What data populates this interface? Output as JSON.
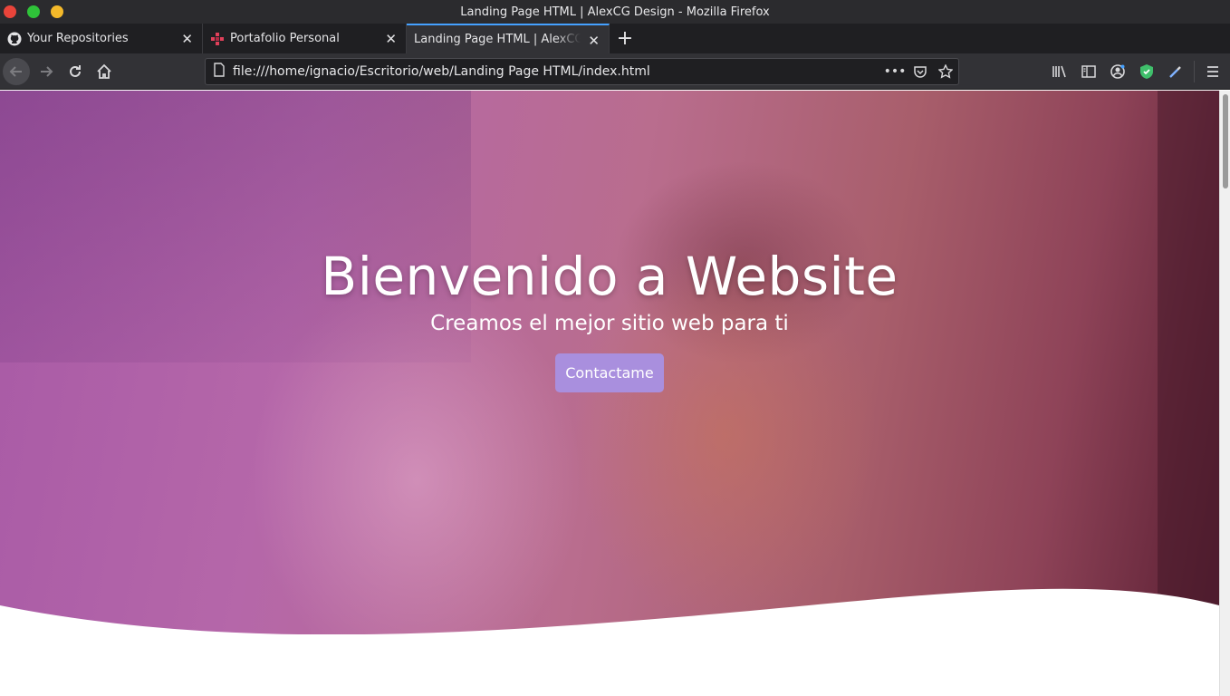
{
  "window": {
    "title": "Landing Page HTML | AlexCG Design - Mozilla Firefox"
  },
  "tabs": [
    {
      "label": "Your Repositories",
      "icon": "github-icon"
    },
    {
      "label": "Portafolio Personal",
      "icon": "portfolio-icon"
    },
    {
      "label": "Landing Page HTML | AlexCG",
      "icon": "none"
    }
  ],
  "toolbar": {
    "url": "file:///home/ignacio/Escritorio/web/Landing Page HTML/index.html",
    "more_label": "•••"
  },
  "hero": {
    "title": "Bienvenido a Website",
    "subtitle": "Creamos el mejor sitio web para ti",
    "button_label": "Contactame"
  },
  "colors": {
    "accent_tab": "#45a1ff",
    "cta": "#a98fde",
    "overlay": "#b567a9"
  }
}
